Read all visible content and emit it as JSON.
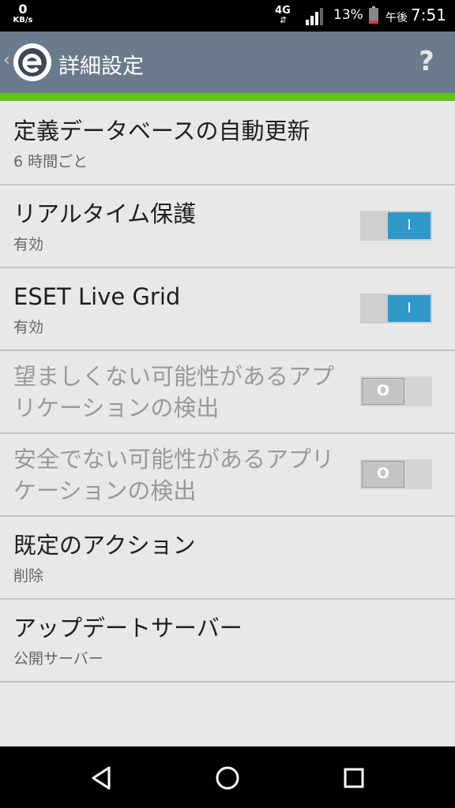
{
  "status_bar": {
    "net_speed": "0",
    "net_unit": "KB/s",
    "network_type": "4G",
    "network_arrows": "⇵",
    "battery_percent": "13%",
    "ampm": "午後",
    "time": "7:51",
    "battery_low_color": "#e53935"
  },
  "appbar": {
    "back_glyph": "‹",
    "title": "詳細設定",
    "help_glyph": "?",
    "accent_color": "#63c21e",
    "bar_color": "#6b7b8d"
  },
  "settings": [
    {
      "title": "定義データベースの自動更新",
      "subtitle": "6 時間ごと"
    },
    {
      "title": "リアルタイム保護",
      "subtitle": "有効",
      "toggle": "on",
      "toggle_label": "I"
    },
    {
      "title": "ESET Live Grid",
      "subtitle": "有効",
      "toggle": "on",
      "toggle_label": "I"
    },
    {
      "title": "望ましくない可能性があるアプリケーションの検出",
      "toggle": "off",
      "toggle_label": "O"
    },
    {
      "title": "安全でない可能性があるアプリケーションの検出",
      "toggle": "off",
      "toggle_label": "O"
    },
    {
      "title": "既定のアクション",
      "subtitle": "削除"
    },
    {
      "title": "アップデートサーバー",
      "subtitle": "公開サーバー"
    }
  ],
  "navbar": {
    "back_icon": "triangle-back-icon",
    "home_icon": "circle-home-icon",
    "recents_icon": "square-recents-icon"
  }
}
